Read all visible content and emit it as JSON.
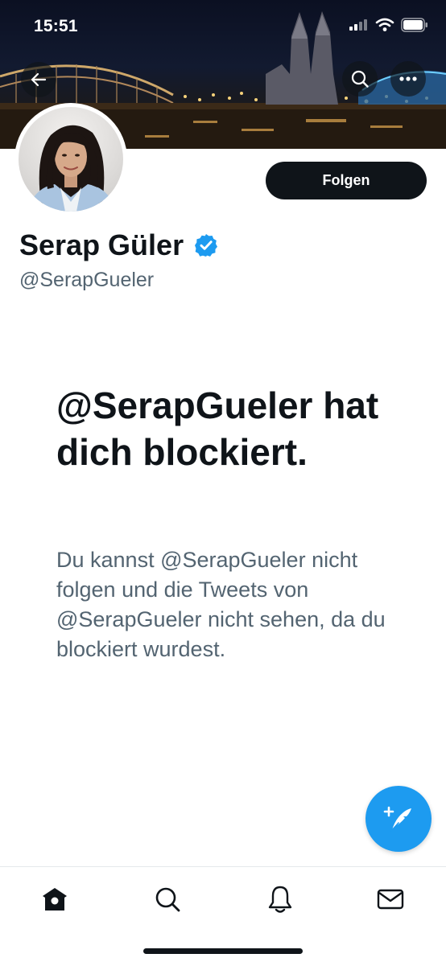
{
  "status_bar": {
    "time": "15:51"
  },
  "header": {
    "back_icon": "arrow-left-icon",
    "search_icon": "search-icon",
    "more_icon": "more-horizontal-icon"
  },
  "profile": {
    "display_name": "Serap Güler",
    "handle": "@SerapGueler",
    "verified": true,
    "follow_label": "Folgen"
  },
  "blocked": {
    "title": "@SerapGueler hat dich blockiert.",
    "description": "Du kannst @SerapGueler nicht folgen und die Tweets von @SerapGueler nicht sehen, da du blockiert wurdest."
  },
  "fab": {
    "icon": "compose-tweet-icon"
  },
  "bottom_nav": [
    {
      "icon": "home-icon"
    },
    {
      "icon": "search-icon"
    },
    {
      "icon": "notifications-icon"
    },
    {
      "icon": "messages-icon"
    }
  ],
  "colors": {
    "accent": "#1d9bf0",
    "text_primary": "#0f1419",
    "text_secondary": "#536471"
  }
}
